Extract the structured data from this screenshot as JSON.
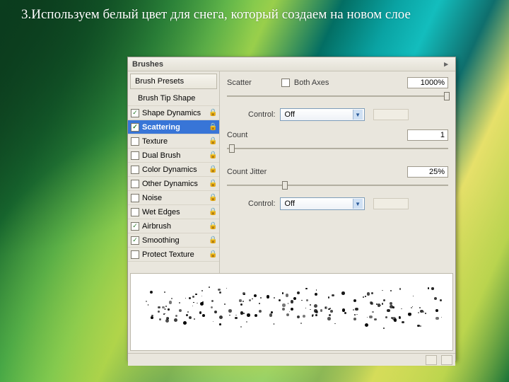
{
  "caption": "3.Используем белый цвет для снега, который создаем на новом слое",
  "panel": {
    "title": "Brushes"
  },
  "sidebar": {
    "presets": "Brush Presets",
    "tipshape": "Brush Tip Shape",
    "rows": [
      {
        "label": "Shape Dynamics",
        "checked": true,
        "selected": false
      },
      {
        "label": "Scattering",
        "checked": true,
        "selected": true
      },
      {
        "label": "Texture",
        "checked": false,
        "selected": false
      },
      {
        "label": "Dual Brush",
        "checked": false,
        "selected": false
      },
      {
        "label": "Color Dynamics",
        "checked": false,
        "selected": false
      },
      {
        "label": "Other Dynamics",
        "checked": false,
        "selected": false
      },
      {
        "label": "Noise",
        "checked": false,
        "selected": false
      },
      {
        "label": "Wet Edges",
        "checked": false,
        "selected": false
      },
      {
        "label": "Airbrush",
        "checked": true,
        "selected": false
      },
      {
        "label": "Smoothing",
        "checked": true,
        "selected": false
      },
      {
        "label": "Protect Texture",
        "checked": false,
        "selected": false
      }
    ]
  },
  "settings": {
    "scatter": {
      "label": "Scatter",
      "bothaxes_label": "Both Axes",
      "bothaxes_checked": false,
      "value": "1000%",
      "thumb_pct": 98
    },
    "control1": {
      "label": "Control:",
      "value": "Off"
    },
    "count": {
      "label": "Count",
      "value": "1",
      "thumb_pct": 1
    },
    "countjitter": {
      "label": "Count Jitter",
      "value": "25%",
      "thumb_pct": 25
    },
    "control2": {
      "label": "Control:",
      "value": "Off"
    }
  }
}
